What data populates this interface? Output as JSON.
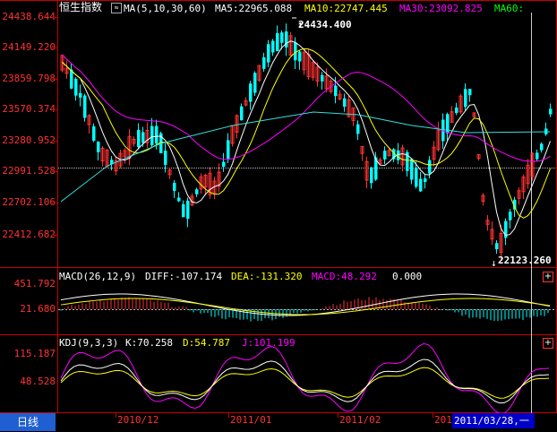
{
  "main_panel": {
    "title": "恒生指数",
    "ma_icon": "chart-mode-icon",
    "ma_label": "MA(5,10,30,60)",
    "ma5": "MA5:22965.088",
    "ma10": "MA10:22747.445",
    "ma30": "MA30:23092.825",
    "ma60": "MA60:",
    "y_labels": [
      "24438.644",
      "24149.220",
      "23859.798",
      "23570.374",
      "23280.952",
      "22991.528",
      "22702.106",
      "22412.682"
    ],
    "high_label": "24434.400",
    "low_label": "22123.260"
  },
  "macd_panel": {
    "header": "MACD(26,12,9)",
    "diff": "DIFF:-107.174",
    "dea": "DEA:-131.320",
    "macd": "MACD:48.292",
    "extra": "0.000",
    "y_labels": [
      "451.792",
      "21.680"
    ],
    "plus": "+"
  },
  "kdj_panel": {
    "header": "KDJ(9,3,3)",
    "k": "K:70.258",
    "d": "D:54.787",
    "j": "J:101.199",
    "y_labels": [
      "115.187",
      "48.528"
    ],
    "plus": "+"
  },
  "x_axis": {
    "tab_label": "日线",
    "labels": [
      "2010/12",
      "2011/01",
      "2011/02",
      "201"
    ],
    "cursor_date": "2011/03/28,一"
  },
  "colors": {
    "up": "#ff3232",
    "down": "#00ffff",
    "ma5": "#ffffff",
    "ma10": "#ffff00",
    "ma30": "#ff00ff",
    "ma60": "#00ff00",
    "axis": "#c80000"
  }
}
